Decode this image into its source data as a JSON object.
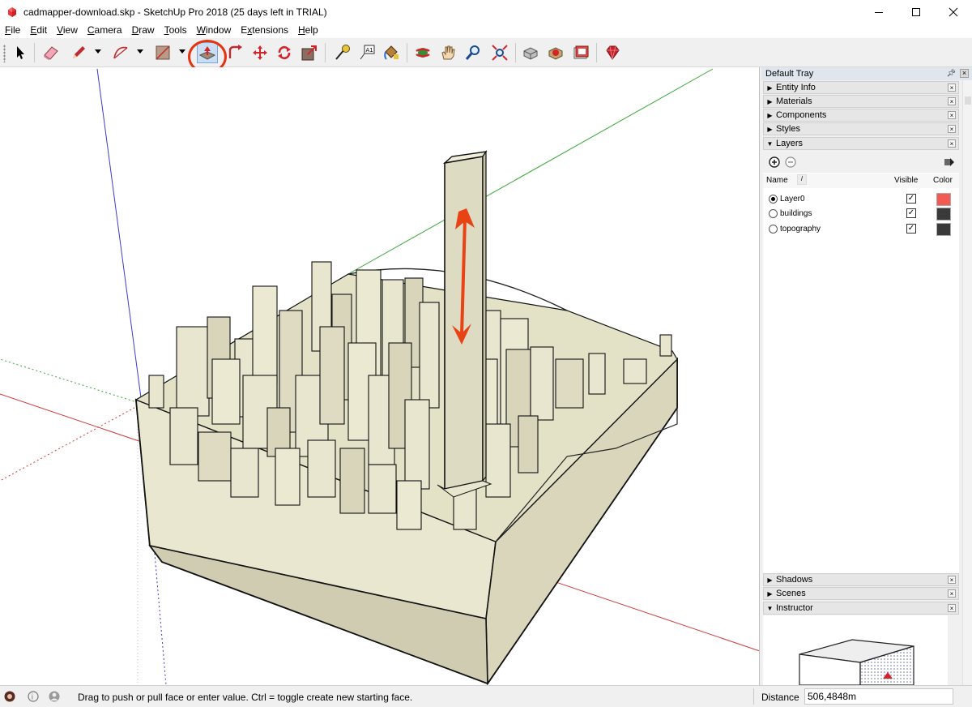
{
  "window": {
    "title": "cadmapper-download.skp - SketchUp Pro 2018 (25 days left in TRIAL)",
    "controls": [
      "minimize-icon",
      "maximize-icon",
      "close-icon"
    ]
  },
  "menu": [
    {
      "label": "File",
      "key": "F"
    },
    {
      "label": "Edit",
      "key": "E"
    },
    {
      "label": "View",
      "key": "V"
    },
    {
      "label": "Camera",
      "key": "C"
    },
    {
      "label": "Draw",
      "key": "D"
    },
    {
      "label": "Tools",
      "key": "T"
    },
    {
      "label": "Window",
      "key": "W"
    },
    {
      "label": "Extensions",
      "key": "x"
    },
    {
      "label": "Help",
      "key": "H"
    }
  ],
  "toolbar": {
    "active_tool": "push-pull",
    "highlight_color": "#e53312",
    "tools": [
      "select",
      "eraser",
      "pencil",
      "arc",
      "rectangle",
      "push-pull",
      "offset",
      "move",
      "rotate",
      "scale",
      "tape-measure",
      "text",
      "paint-bucket",
      "orbit",
      "pan",
      "zoom",
      "zoom-extents",
      "3d-warehouse",
      "extension-warehouse",
      "layout",
      "ruby"
    ]
  },
  "tray": {
    "title": "Default Tray",
    "panels_top": [
      {
        "label": "Entity Info",
        "expanded": false
      },
      {
        "label": "Materials",
        "expanded": false
      },
      {
        "label": "Components",
        "expanded": false
      },
      {
        "label": "Styles",
        "expanded": false
      },
      {
        "label": "Layers",
        "expanded": true
      }
    ],
    "layers": {
      "columns": {
        "name": "Name",
        "visible": "Visible",
        "color": "Color"
      },
      "rows": [
        {
          "name": "Layer0",
          "active": true,
          "visible": true,
          "color": "#f25a52"
        },
        {
          "name": "buildings",
          "active": false,
          "visible": true,
          "color": "#3a3a3a"
        },
        {
          "name": "topography",
          "active": false,
          "visible": true,
          "color": "#3a3a3a"
        }
      ]
    },
    "panels_bottom": [
      {
        "label": "Shadows",
        "expanded": false
      },
      {
        "label": "Scenes",
        "expanded": false
      },
      {
        "label": "Instructor",
        "expanded": true
      }
    ]
  },
  "status": {
    "message": "Drag to push or pull face or enter value.  Ctrl = toggle create new starting face.",
    "measure_label": "Distance",
    "measure_value": "506,4848m"
  },
  "colors": {
    "model_face": "#e9e7cf",
    "model_shadow": "#cfccb2",
    "axis_red": "#d23b3b",
    "axis_green": "#37a837",
    "axis_blue": "#3b3bd2",
    "arrow": "#e84315"
  }
}
